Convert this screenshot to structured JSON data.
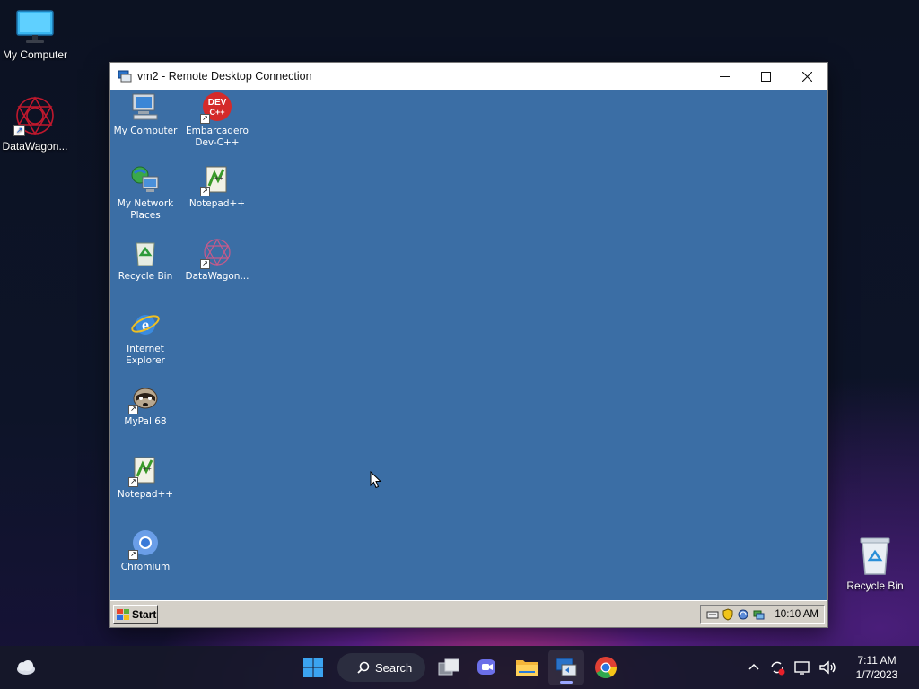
{
  "host_desktop": {
    "icons": [
      {
        "label": "My Computer",
        "icon": "monitor-icon"
      },
      {
        "label": "DataWagon...",
        "icon": "datawagon-icon"
      },
      {
        "label": "Recycle Bin",
        "icon": "recycle-bin-icon"
      }
    ]
  },
  "rdp_window": {
    "title": "vm2 - Remote Desktop Connection",
    "controls": {
      "minimize": "—",
      "maximize": "☐",
      "close": "✕"
    }
  },
  "guest_desktop": {
    "icons": [
      {
        "label": "My Computer",
        "icon": "my-computer-icon"
      },
      {
        "label": "Embarcadero Dev-C++",
        "icon": "devcpp-icon",
        "badge": "DEV C++"
      },
      {
        "label": "My Network Places",
        "icon": "network-places-icon"
      },
      {
        "label": "Notepad++",
        "icon": "notepadpp-icon"
      },
      {
        "label": "Recycle Bin",
        "icon": "recycle-bin-icon"
      },
      {
        "label": "DataWagon...",
        "icon": "datawagon-icon"
      },
      {
        "label": "Internet Explorer",
        "icon": "internet-explorer-icon"
      },
      {
        "label": "MyPal 68",
        "icon": "mypal-icon"
      },
      {
        "label": "Notepad++",
        "icon": "notepadpp-icon"
      },
      {
        "label": "Chromium",
        "icon": "chromium-icon"
      }
    ],
    "taskbar": {
      "start_label": "Start",
      "clock": "10:10 AM"
    }
  },
  "host_taskbar": {
    "search_label": "Search",
    "time": "7:11 AM",
    "date": "1/7/2023"
  }
}
